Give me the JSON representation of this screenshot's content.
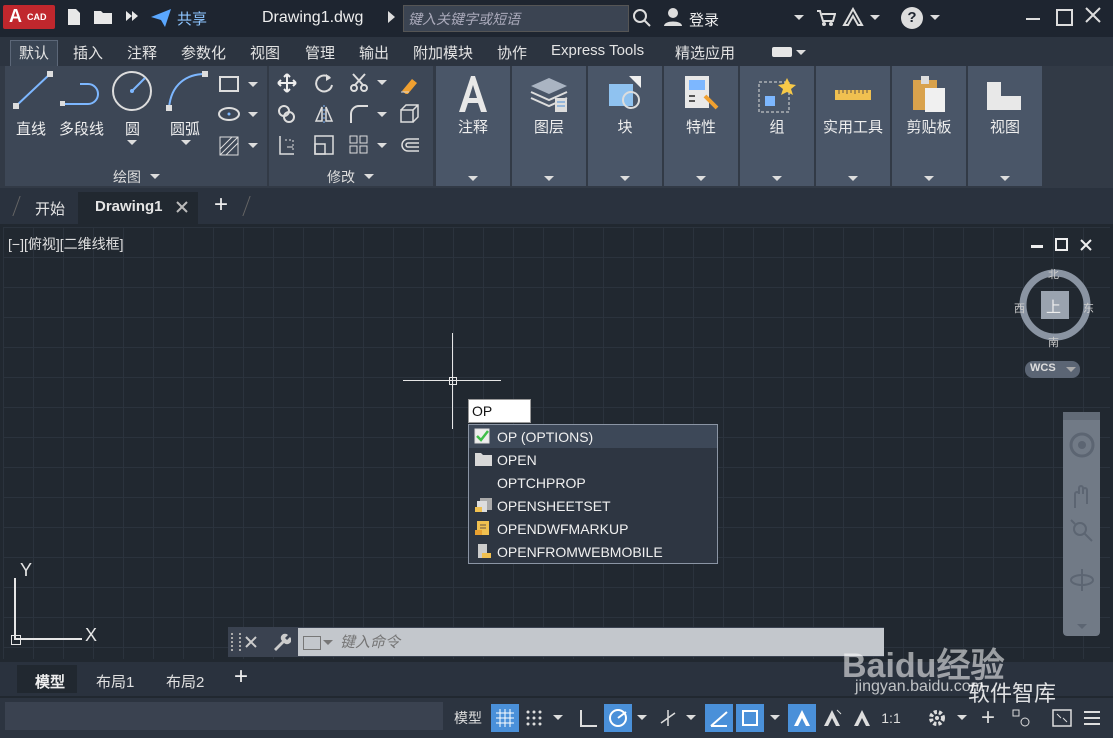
{
  "app": {
    "logo_letter": "A",
    "logo_sub": "CAD"
  },
  "titlebar": {
    "share_label": "共享",
    "document_title": "Drawing1.dwg",
    "search_placeholder": "键入关键字或短语",
    "login_label": "登录",
    "help_label": "?"
  },
  "ribbon_tabs": [
    "默认",
    "插入",
    "注释",
    "参数化",
    "视图",
    "管理",
    "输出",
    "附加模块",
    "协作",
    "Express Tools",
    "精选应用"
  ],
  "draw_panel": {
    "title": "绘图",
    "tools": [
      "直线",
      "多段线",
      "圆",
      "圆弧"
    ]
  },
  "modify_panel": {
    "title": "修改"
  },
  "big_panels": [
    "注释",
    "图层",
    "块",
    "特性",
    "组",
    "实用工具",
    "剪贴板",
    "视图"
  ],
  "file_tabs": {
    "start": "开始",
    "active": "Drawing1",
    "add": "+"
  },
  "viewport": {
    "label": "[−][俯视][二维线框]"
  },
  "viewcube": {
    "north": "北",
    "south": "南",
    "east": "东",
    "west": "西",
    "face": "上",
    "wcs": "WCS"
  },
  "ucs": {
    "x": "X",
    "y": "Y"
  },
  "dynamic_input": {
    "value": "OP"
  },
  "autocomplete": [
    {
      "label": "OP (OPTIONS)",
      "icon": "check-icon",
      "selected": true
    },
    {
      "label": "OPEN",
      "icon": "folder-open-icon"
    },
    {
      "label": "OPTCHPROP",
      "icon": ""
    },
    {
      "label": "OPENSHEETSET",
      "icon": "sheetset-icon"
    },
    {
      "label": "OPENDWFMARKUP",
      "icon": "dwf-markup-icon"
    },
    {
      "label": "OPENFROMWEBMOBILE",
      "icon": "web-mobile-icon"
    }
  ],
  "command_line": {
    "placeholder": "键入命令"
  },
  "layout_tabs": [
    "模型",
    "布局1",
    "布局2"
  ],
  "statusbar": {
    "model_label": "模型",
    "scale": "1:1"
  },
  "watermark": {
    "brand": "Baidu经验",
    "url": "jingyan.baidu.com",
    "sub": "软件智库"
  },
  "colors": {
    "accent_blue": "#4a90d9",
    "logo_red": "#c0272d",
    "check_green": "#3fbf4a"
  }
}
